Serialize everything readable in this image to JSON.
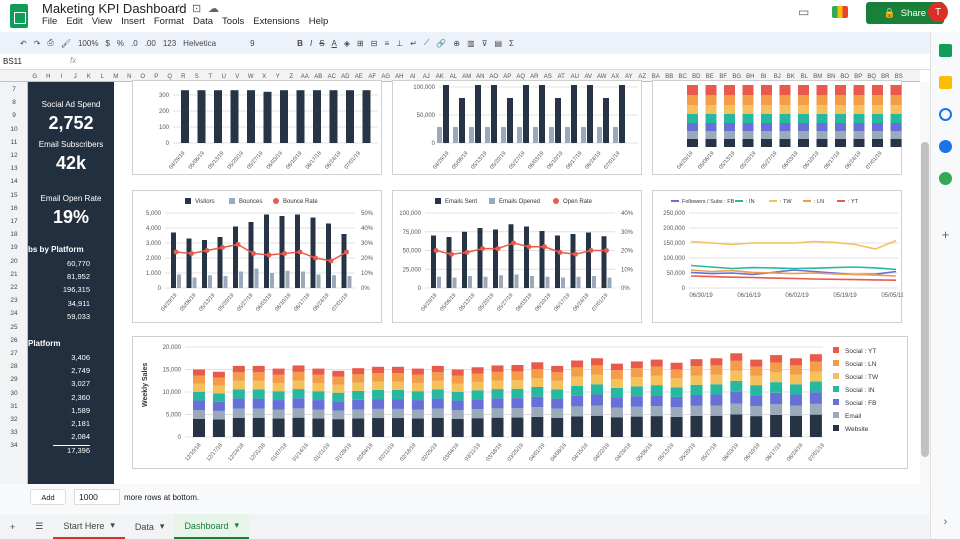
{
  "app": {
    "title": "Maketing KPI Dashboard",
    "share_label": "Share",
    "avatar_letter": "T",
    "menu": [
      "File",
      "Edit",
      "View",
      "Insert",
      "Format",
      "Data",
      "Tools",
      "Extensions",
      "Help"
    ]
  },
  "toolbar": {
    "zoom": "100%",
    "currency": "$",
    "percent": "%",
    "dec_minus": ".0",
    "dec_plus": ".00",
    "format_more": "123",
    "font": "Helvetica",
    "font_size": "9",
    "bold": "B",
    "italic": "I",
    "strike": "S",
    "text_color": "A"
  },
  "formula": {
    "cell": "BS11",
    "fx": "fx"
  },
  "columns": [
    "G",
    "H",
    "I",
    "J",
    "K",
    "L",
    "M",
    "N",
    "O",
    "P",
    "Q",
    "R",
    "S",
    "T",
    "U",
    "V",
    "W",
    "X",
    "Y",
    "Z",
    "AA",
    "AB",
    "AC",
    "AD",
    "AE",
    "AF",
    "AG",
    "AH",
    "AI",
    "AJ",
    "AK",
    "AL",
    "AM",
    "AN",
    "AO",
    "AP",
    "AQ",
    "AR",
    "AS",
    "AT",
    "AU",
    "AV",
    "AW",
    "AX",
    "AY",
    "AZ",
    "BA",
    "BB",
    "BC",
    "BD",
    "BE",
    "BF",
    "BG",
    "BH",
    "BI",
    "BJ",
    "BK",
    "BL",
    "BM",
    "BN",
    "BO",
    "BP",
    "BQ",
    "BR",
    "BS"
  ],
  "rows": [
    "7",
    "8",
    "9",
    "10",
    "11",
    "12",
    "13",
    "14",
    "15",
    "16",
    "17",
    "18",
    "19",
    "20",
    "21",
    "22",
    "23",
    "24",
    "25",
    "26",
    "27",
    "28",
    "29",
    "30",
    "31",
    "32",
    "33",
    "34"
  ],
  "sidebar": {
    "kpis": [
      {
        "label": "Social Ad Spend",
        "value": "2,752"
      },
      {
        "label": "Email Subscribers",
        "value": "42k"
      },
      {
        "label": "Email Open Rate",
        "value": "19%"
      }
    ],
    "section1": "bs by Platform",
    "section1_values": [
      "60,770",
      "81,952",
      "196,315",
      "34,911",
      "59,033"
    ],
    "section2": "Platform",
    "section2_values": [
      "3,406",
      "2,749",
      "3,027",
      "2,360",
      "1,589",
      "2,181",
      "2,084",
      "17,396"
    ]
  },
  "colors": {
    "navy": "#263445",
    "grey": "#9aaabb",
    "red": "#e85b4b",
    "orange": "#f39c4a",
    "yellow": "#f5c15c",
    "teal": "#27b8a0",
    "blue": "#6670d6",
    "grid": "#e0e0e0"
  },
  "charts": {
    "top_left": {
      "y_ticks": [
        "300",
        "200",
        "100",
        "0"
      ],
      "x_labels": [
        "04/29/19",
        "05/06/19",
        "05/13/19",
        "05/20/19",
        "05/27/19",
        "06/03/19",
        "06/10/19",
        "06/17/19",
        "06/24/19",
        "07/01/19"
      ]
    },
    "top_mid": {
      "y_ticks": [
        "100,000",
        "50,000",
        "0"
      ],
      "x_labels": [
        "04/29/19",
        "05/06/19",
        "05/13/19",
        "05/20/19",
        "05/27/19",
        "06/03/19",
        "06/10/19",
        "06/17/19",
        "06/24/19",
        "07/01/19"
      ]
    },
    "top_right": {
      "x_labels": [
        "04/29/19",
        "05/06/19",
        "05/13/19",
        "05/20/19",
        "05/27/19",
        "06/03/19",
        "06/10/19",
        "06/17/19",
        "06/24/19",
        "07/01/19"
      ]
    },
    "traffic": {
      "legend": [
        "Visitors",
        "Bounces",
        "Bounce Rate"
      ],
      "y_left": [
        "5,000",
        "4,000",
        "3,000",
        "2,000",
        "1,000",
        "0"
      ],
      "y_right": [
        "50%",
        "40%",
        "30%",
        "20%",
        "10%",
        "0%"
      ],
      "x_labels": [
        "04/29/19",
        "05/06/19",
        "05/13/19",
        "05/20/19",
        "05/27/19",
        "06/03/19",
        "06/10/19",
        "06/17/19",
        "06/24/19",
        "07/01/19"
      ],
      "visitors": [
        3700,
        3300,
        3200,
        3400,
        4100,
        4400,
        4900,
        4800,
        4900,
        4700,
        4300,
        3600
      ],
      "bounces": [
        900,
        700,
        850,
        800,
        1100,
        1300,
        1000,
        1150,
        1100,
        900,
        850,
        800
      ],
      "rate": [
        24,
        23,
        25,
        27,
        29,
        23,
        22,
        23,
        24,
        20,
        18,
        24
      ]
    },
    "email": {
      "legend": [
        "Emails Sent",
        "Emails Opened",
        "Open Rate"
      ],
      "y_left": [
        "100,000",
        "75,000",
        "50,000",
        "25,000",
        "0"
      ],
      "y_right": [
        "40%",
        "30%",
        "20%",
        "10%",
        "0%"
      ],
      "x_labels": [
        "04/29/19",
        "05/06/19",
        "05/13/19",
        "05/20/19",
        "05/27/19",
        "06/03/19",
        "06/10/19",
        "06/17/19",
        "06/24/19",
        "07/01/19"
      ],
      "sent": [
        70000,
        68000,
        75000,
        80000,
        78000,
        85000,
        82000,
        76000,
        70000,
        72000,
        74000,
        69000
      ],
      "opened": [
        15000,
        14000,
        16000,
        15000,
        17000,
        18000,
        16000,
        15000,
        14000,
        15000,
        16000,
        14000
      ],
      "rate": [
        20,
        18,
        19,
        21,
        21,
        24,
        22,
        22,
        19,
        18,
        20,
        20
      ]
    },
    "followers": {
      "legend": [
        "Followers / Subs : FB",
        ": IN",
        ": TW",
        ": LN",
        ": YT"
      ],
      "y_ticks": [
        "250,000",
        "200,000",
        "150,000",
        "100,000",
        "50,000",
        "0"
      ],
      "x_labels": [
        "06/30/19",
        "06/16/19",
        "06/02/19",
        "05/19/19",
        "05/05/19"
      ],
      "series": {
        "TW": [
          155000,
          150000,
          145000,
          150000,
          150000,
          150000,
          155000,
          152000,
          145000,
          130000,
          158000
        ],
        "IN": [
          75000,
          70000,
          65000,
          68000,
          67000,
          65000,
          66000,
          68000,
          70000,
          67000,
          62000
        ],
        "LN": [
          60000,
          55000,
          58000,
          52000,
          50000,
          48000,
          50000,
          47000,
          45000,
          43000,
          40000
        ],
        "FB": [
          52000,
          48000,
          50000,
          45000,
          52000,
          60000,
          55000,
          50000,
          45000,
          46000,
          55000
        ],
        "YT": [
          40000,
          38000,
          36000,
          35000,
          33000,
          32000,
          30000,
          29000,
          28000,
          27000,
          26000
        ]
      }
    },
    "weekly": {
      "ylabel": "Weekly Sales",
      "y_ticks": [
        "20,000",
        "15,000",
        "10,000",
        "5,000",
        "0"
      ],
      "x_labels": [
        "12/10/18",
        "12/17/18",
        "12/24/18",
        "12/31/18",
        "01/07/19",
        "01/14/19",
        "01/21/19",
        "01/28/19",
        "02/04/19",
        "02/11/19",
        "02/18/19",
        "02/25/19",
        "03/04/19",
        "03/11/19",
        "03/18/19",
        "03/25/19",
        "04/01/19",
        "04/08/19",
        "04/15/19",
        "04/22/19",
        "04/29/19",
        "05/06/19",
        "05/13/19",
        "05/20/19",
        "05/27/19",
        "06/03/19",
        "06/10/19",
        "06/17/19",
        "06/24/19",
        "07/01/19",
        "07/08/19",
        "07/15/19"
      ],
      "legend": [
        "Social : YT",
        "Social : LN",
        "Social : TW",
        "Social : IN",
        "Social : FB",
        "Email",
        "Website"
      ],
      "totals": [
        15000,
        14500,
        15800,
        15800,
        15200,
        15900,
        15200,
        14700,
        15300,
        15600,
        15600,
        15200,
        15800,
        15000,
        15500,
        15900,
        16000,
        16600,
        15800,
        17000,
        17500,
        16300,
        16800,
        17200,
        16500,
        17300,
        17500,
        18600,
        17200,
        18200,
        17500,
        18400
      ]
    }
  }
}
